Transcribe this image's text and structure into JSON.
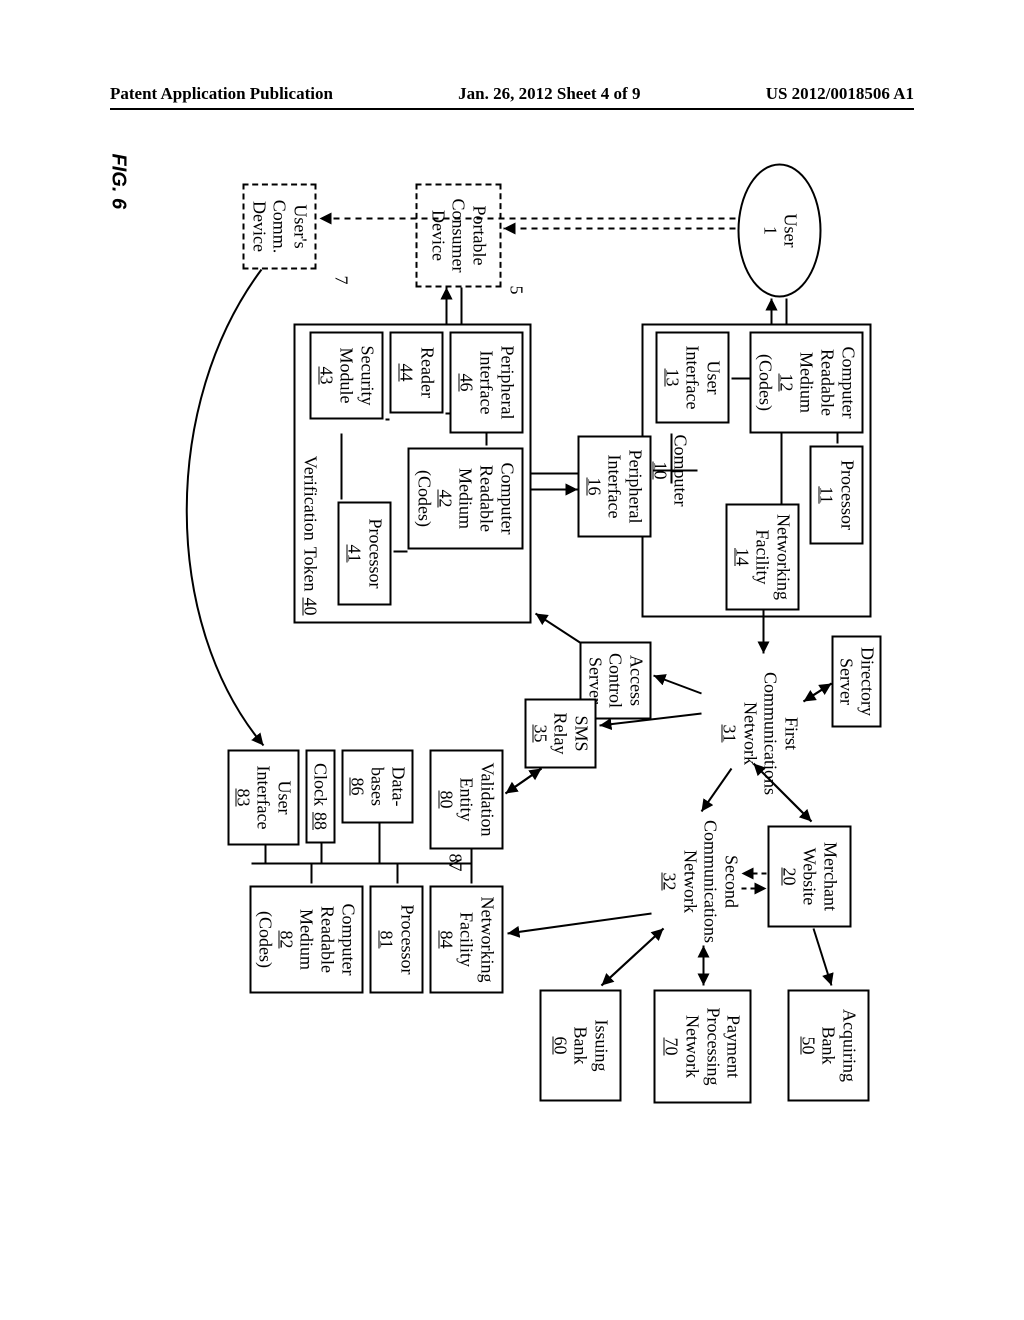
{
  "header": {
    "left": "Patent Application Publication",
    "center": "Jan. 26, 2012  Sheet 4 of 9",
    "right": "US 2012/0018506 A1"
  },
  "fig": {
    "label": "FIG. 6"
  },
  "user": {
    "name": "User",
    "num": "1"
  },
  "computer": {
    "name": "Computer",
    "num": "10"
  },
  "comp_crm": {
    "l1": "Computer",
    "l2": "Readable",
    "l3": "Medium",
    "num": "12",
    "l5": "(Codes)"
  },
  "comp_proc": {
    "name": "Processor",
    "num": "11"
  },
  "comp_net": {
    "l1": "Networking",
    "l2": "Facility",
    "num": "14"
  },
  "comp_ui": {
    "l1": "User",
    "l2": "Interface",
    "num": "13"
  },
  "comp_pi": {
    "l1": "Peripheral",
    "l2": "Interface",
    "num": "16"
  },
  "pcd": {
    "l1": "Portable",
    "l2": "Consumer",
    "l3": "Device",
    "num": "5"
  },
  "ucd": {
    "l1": "User's",
    "l2": "Comm.",
    "l3": "Device",
    "num": "7"
  },
  "vt": {
    "l1": "Verification",
    "l2": "Token",
    "num": "40"
  },
  "vt_pi": {
    "l1": "Peripheral",
    "l2": "Interface",
    "num": "46"
  },
  "vt_rdr": {
    "name": "Reader",
    "num": "44"
  },
  "vt_sec": {
    "l1": "Security",
    "l2": "Module",
    "num": "43"
  },
  "vt_crm": {
    "l1": "Computer",
    "l2": "Readable",
    "l3": "Medium",
    "num": "42",
    "l5": "(Codes)"
  },
  "vt_proc": {
    "name": "Processor",
    "num": "41"
  },
  "dir": {
    "l1": "Directory",
    "l2": "Server"
  },
  "acs": {
    "l1": "Access",
    "l2": "Control",
    "l3": "Server"
  },
  "fcn": {
    "l1": "First",
    "l2": "Communications",
    "l3": "Network",
    "num": "31"
  },
  "sms": {
    "l1": "SMS",
    "l2": "Relay",
    "num": "35"
  },
  "mw": {
    "l1": "Merchant",
    "l2": "Website",
    "num": "20"
  },
  "scn": {
    "l1": "Second",
    "l2": "Communications",
    "l3": "Network",
    "num": "32"
  },
  "ab": {
    "l1": "Acquiring",
    "l2": "Bank",
    "num": "50"
  },
  "ppn": {
    "l1": "Payment",
    "l2": "Processing",
    "l3": "Network",
    "num": "70"
  },
  "ib": {
    "l1": "Issuing",
    "l2": "Bank",
    "num": "60"
  },
  "ve": {
    "l1": "Validation",
    "l2": "Entity",
    "num": "80"
  },
  "ve_db": {
    "l1": "Data-",
    "l2": "bases",
    "num": "86"
  },
  "ve_clk": {
    "name": "Clock",
    "num": "88"
  },
  "ve_ui": {
    "l1": "User",
    "l2": "Interface",
    "num": "83"
  },
  "ve_net": {
    "l1": "Networking",
    "l2": "Facility",
    "num": "84"
  },
  "ve_proc": {
    "name": "Processor",
    "num": "81"
  },
  "ve_crm": {
    "l1": "Computer",
    "l2": "Readable",
    "l3": "Medium",
    "num": "82",
    "l5": "(Codes)"
  },
  "ve_87": "87"
}
